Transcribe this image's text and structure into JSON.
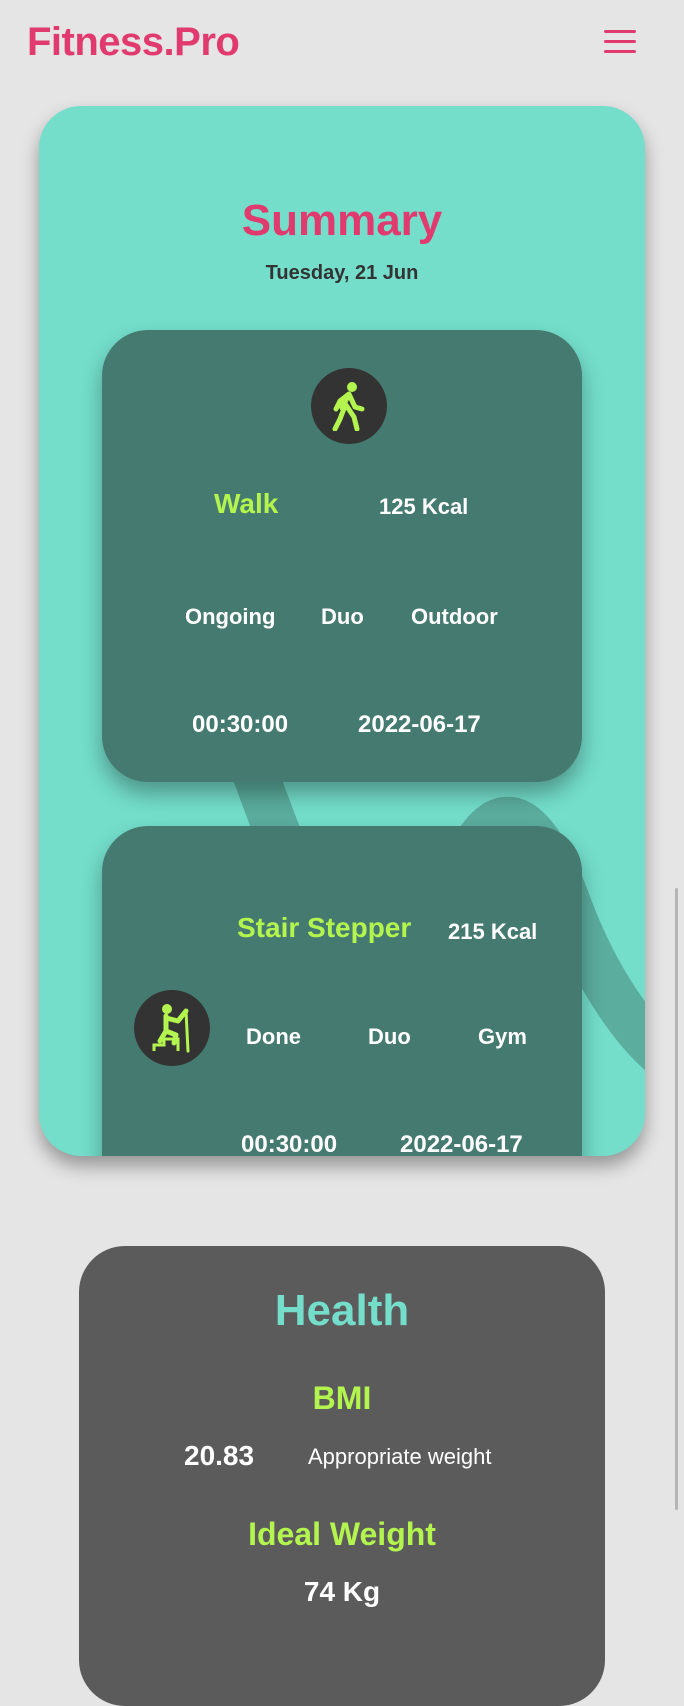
{
  "header": {
    "brand": "Fitness.Pro",
    "menu_icon": "hamburger-menu-icon"
  },
  "summary": {
    "title": "Summary",
    "date": "Tuesday, 21 Jun",
    "activities": [
      {
        "icon": "walk-icon",
        "name": "Walk",
        "kcal": "125 Kcal",
        "status": "Ongoing",
        "mode": "Duo",
        "location": "Outdoor",
        "duration": "00:30:00",
        "date": "2022-06-17"
      },
      {
        "icon": "stair-stepper-icon",
        "name": "Stair Stepper",
        "kcal": "215 Kcal",
        "status": "Done",
        "mode": "Duo",
        "location": "Gym",
        "duration": "00:30:00",
        "date": "2022-06-17"
      }
    ]
  },
  "health": {
    "title": "Health",
    "bmi_label": "BMI",
    "bmi_value": "20.83",
    "bmi_status": "Appropriate weight",
    "ideal_weight_label": "Ideal Weight",
    "ideal_weight_value": "74 Kg"
  },
  "colors": {
    "brand": "#e03a6e",
    "panel": "#74decb",
    "card": "#457a70",
    "accent": "#b3f54e",
    "health_card": "#5b5b5b"
  }
}
